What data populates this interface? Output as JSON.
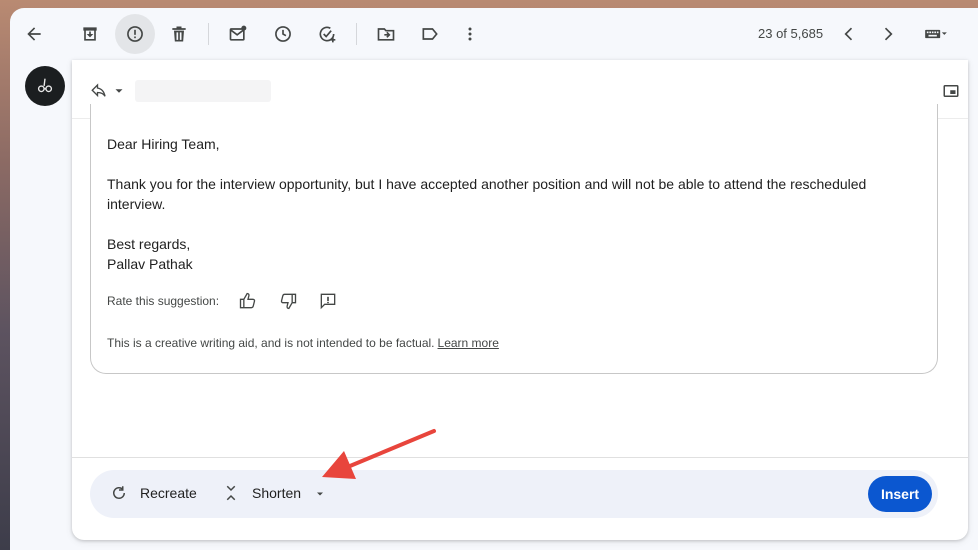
{
  "toolbar": {
    "back": "arrow-left-icon",
    "archive": "archive-icon",
    "report_spam": "report-icon",
    "delete": "trash-icon",
    "mark_unread": "mail-unread-icon",
    "snooze": "clock-icon",
    "add_task": "add-task-icon",
    "move_to": "move-folder-icon",
    "label": "label-icon",
    "more": "more-vert-icon",
    "counter": "23 of 5,685",
    "prev": "chevron-left-icon",
    "next": "chevron-right-icon",
    "input_tools": "keyboard-icon"
  },
  "compose": {
    "reply_icon": "reply-icon",
    "popout_icon": "popout-icon"
  },
  "suggestion": {
    "greeting": "Dear Hiring Team,",
    "body": "Thank you for the interview opportunity, but I have accepted another position and will not be able to attend the rescheduled interview.",
    "closing_line1": "Best regards,",
    "closing_line2": "Pallav Pathak",
    "rate_label": "Rate this suggestion:",
    "disclaimer": "This is a creative writing aid, and is not intended to be factual.",
    "learn_more": "Learn more"
  },
  "actions": {
    "recreate": "Recreate",
    "shorten": "Shorten",
    "insert": "Insert"
  },
  "colors": {
    "accent": "#0b57d0",
    "annotation": "#e8453c"
  }
}
